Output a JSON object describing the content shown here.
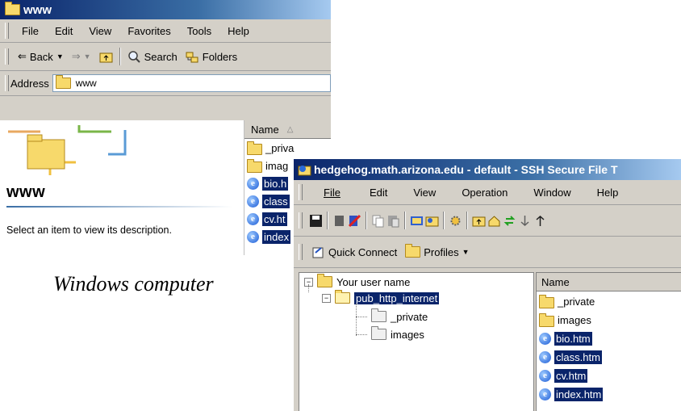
{
  "explorer": {
    "title": "www",
    "menu": [
      "File",
      "Edit",
      "View",
      "Favorites",
      "Tools",
      "Help"
    ],
    "toolbar": {
      "back": "Back",
      "search": "Search",
      "folders": "Folders"
    },
    "address_label": "Address",
    "address_value": "www",
    "folder_name": "www",
    "description": "Select an item to view its description.",
    "column_name": "Name",
    "files": [
      {
        "name": "_priva",
        "icon": "folder-icon",
        "selected": false
      },
      {
        "name": "imag",
        "icon": "folder-icon",
        "selected": false
      },
      {
        "name": "bio.h",
        "icon": "ie-page-icon",
        "selected": true
      },
      {
        "name": "class",
        "icon": "ie-page-icon",
        "selected": true
      },
      {
        "name": "cv.ht",
        "icon": "ie-page-icon",
        "selected": true
      },
      {
        "name": "index",
        "icon": "ie-page-icon",
        "selected": true
      }
    ]
  },
  "caption": "Windows computer",
  "ssh": {
    "title": "hedgehog.math.arizona.edu - default - SSH Secure File T",
    "menu": [
      "File",
      "Edit",
      "View",
      "Operation",
      "Window",
      "Help"
    ],
    "quick_connect": "Quick Connect",
    "profiles": "Profiles",
    "tree": {
      "root": "Your user name",
      "current": "pub_http_internet",
      "children": [
        "_private",
        "images"
      ]
    },
    "column_name": "Name",
    "files": [
      {
        "name": "_private",
        "icon": "folder-icon",
        "selected": false
      },
      {
        "name": "images",
        "icon": "folder-icon",
        "selected": false
      },
      {
        "name": "bio.htm",
        "icon": "ie-page-icon",
        "selected": true
      },
      {
        "name": "class.htm",
        "icon": "ie-page-icon",
        "selected": true
      },
      {
        "name": "cv.htm",
        "icon": "ie-page-icon",
        "selected": true
      },
      {
        "name": "index.htm",
        "icon": "ie-page-icon",
        "selected": true
      }
    ]
  },
  "colors": {
    "selection": "#0a246a",
    "titlebar": "#0a246a",
    "window_face": "#d4d0c8"
  }
}
